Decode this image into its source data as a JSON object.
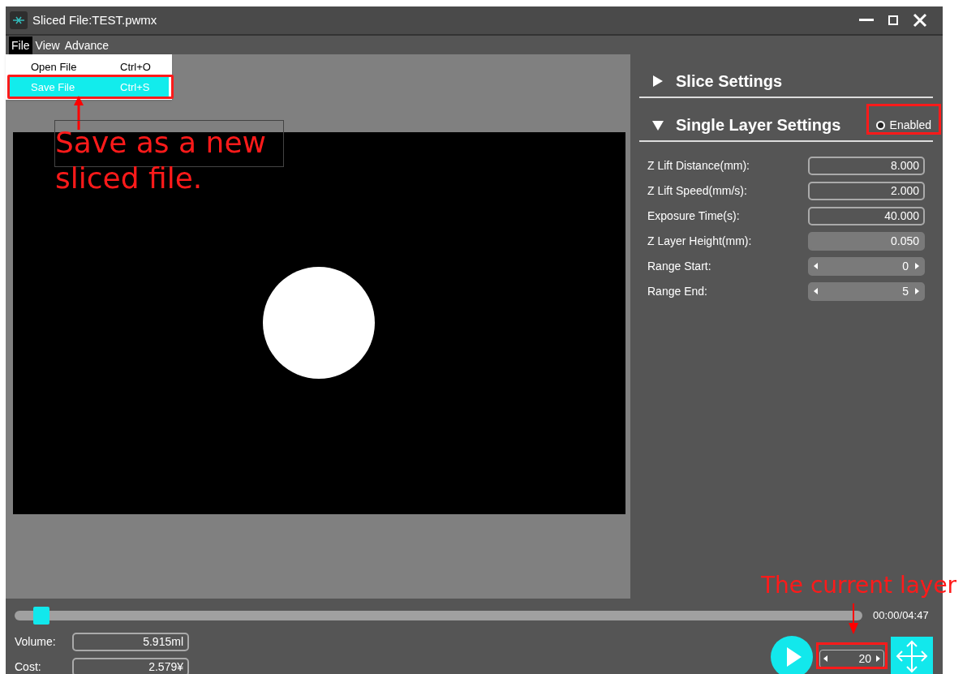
{
  "window": {
    "title": "Sliced File:TEST.pwmx"
  },
  "menu": [
    {
      "label": "File",
      "selected": true
    },
    {
      "label": "View",
      "selected": false
    },
    {
      "label": "Advance",
      "selected": false
    }
  ],
  "file_menu": [
    {
      "label": "Open File",
      "shortcut": "Ctrl+O",
      "selected": false
    },
    {
      "label": "Save File",
      "shortcut": "Ctrl+S",
      "selected": true
    }
  ],
  "sections": [
    {
      "title": "Slice Settings",
      "expanded": false
    },
    {
      "title": "Single Layer Settings",
      "expanded": true,
      "enabled_label": "Enabled",
      "enabled": false
    }
  ],
  "fields": [
    {
      "label": "Z Lift Distance(mm):",
      "value": "8.000",
      "kind": "number",
      "disabled": false
    },
    {
      "label": "Z Lift Speed(mm/s):",
      "value": "2.000",
      "kind": "number",
      "disabled": false
    },
    {
      "label": "Exposure Time(s):",
      "value": "40.000",
      "kind": "number",
      "disabled": false
    },
    {
      "label": "Z Layer Height(mm):",
      "value": "0.050",
      "kind": "number",
      "disabled": true
    },
    {
      "label": "Range Start:",
      "value": "0",
      "kind": "spinner"
    },
    {
      "label": "Range End:",
      "value": "5",
      "kind": "spinner"
    }
  ],
  "playback": {
    "level": 0.022,
    "time": "00:00/04:47",
    "layer": "20"
  },
  "stats": [
    {
      "label": "Volume:",
      "value": "5.915ml"
    },
    {
      "label": "Cost:",
      "value": "2.579¥"
    }
  ],
  "annotations": [
    {
      "kind": "menu",
      "text": "Save as a new sliced file."
    },
    {
      "kind": "layer",
      "text": "The current layer"
    }
  ]
}
